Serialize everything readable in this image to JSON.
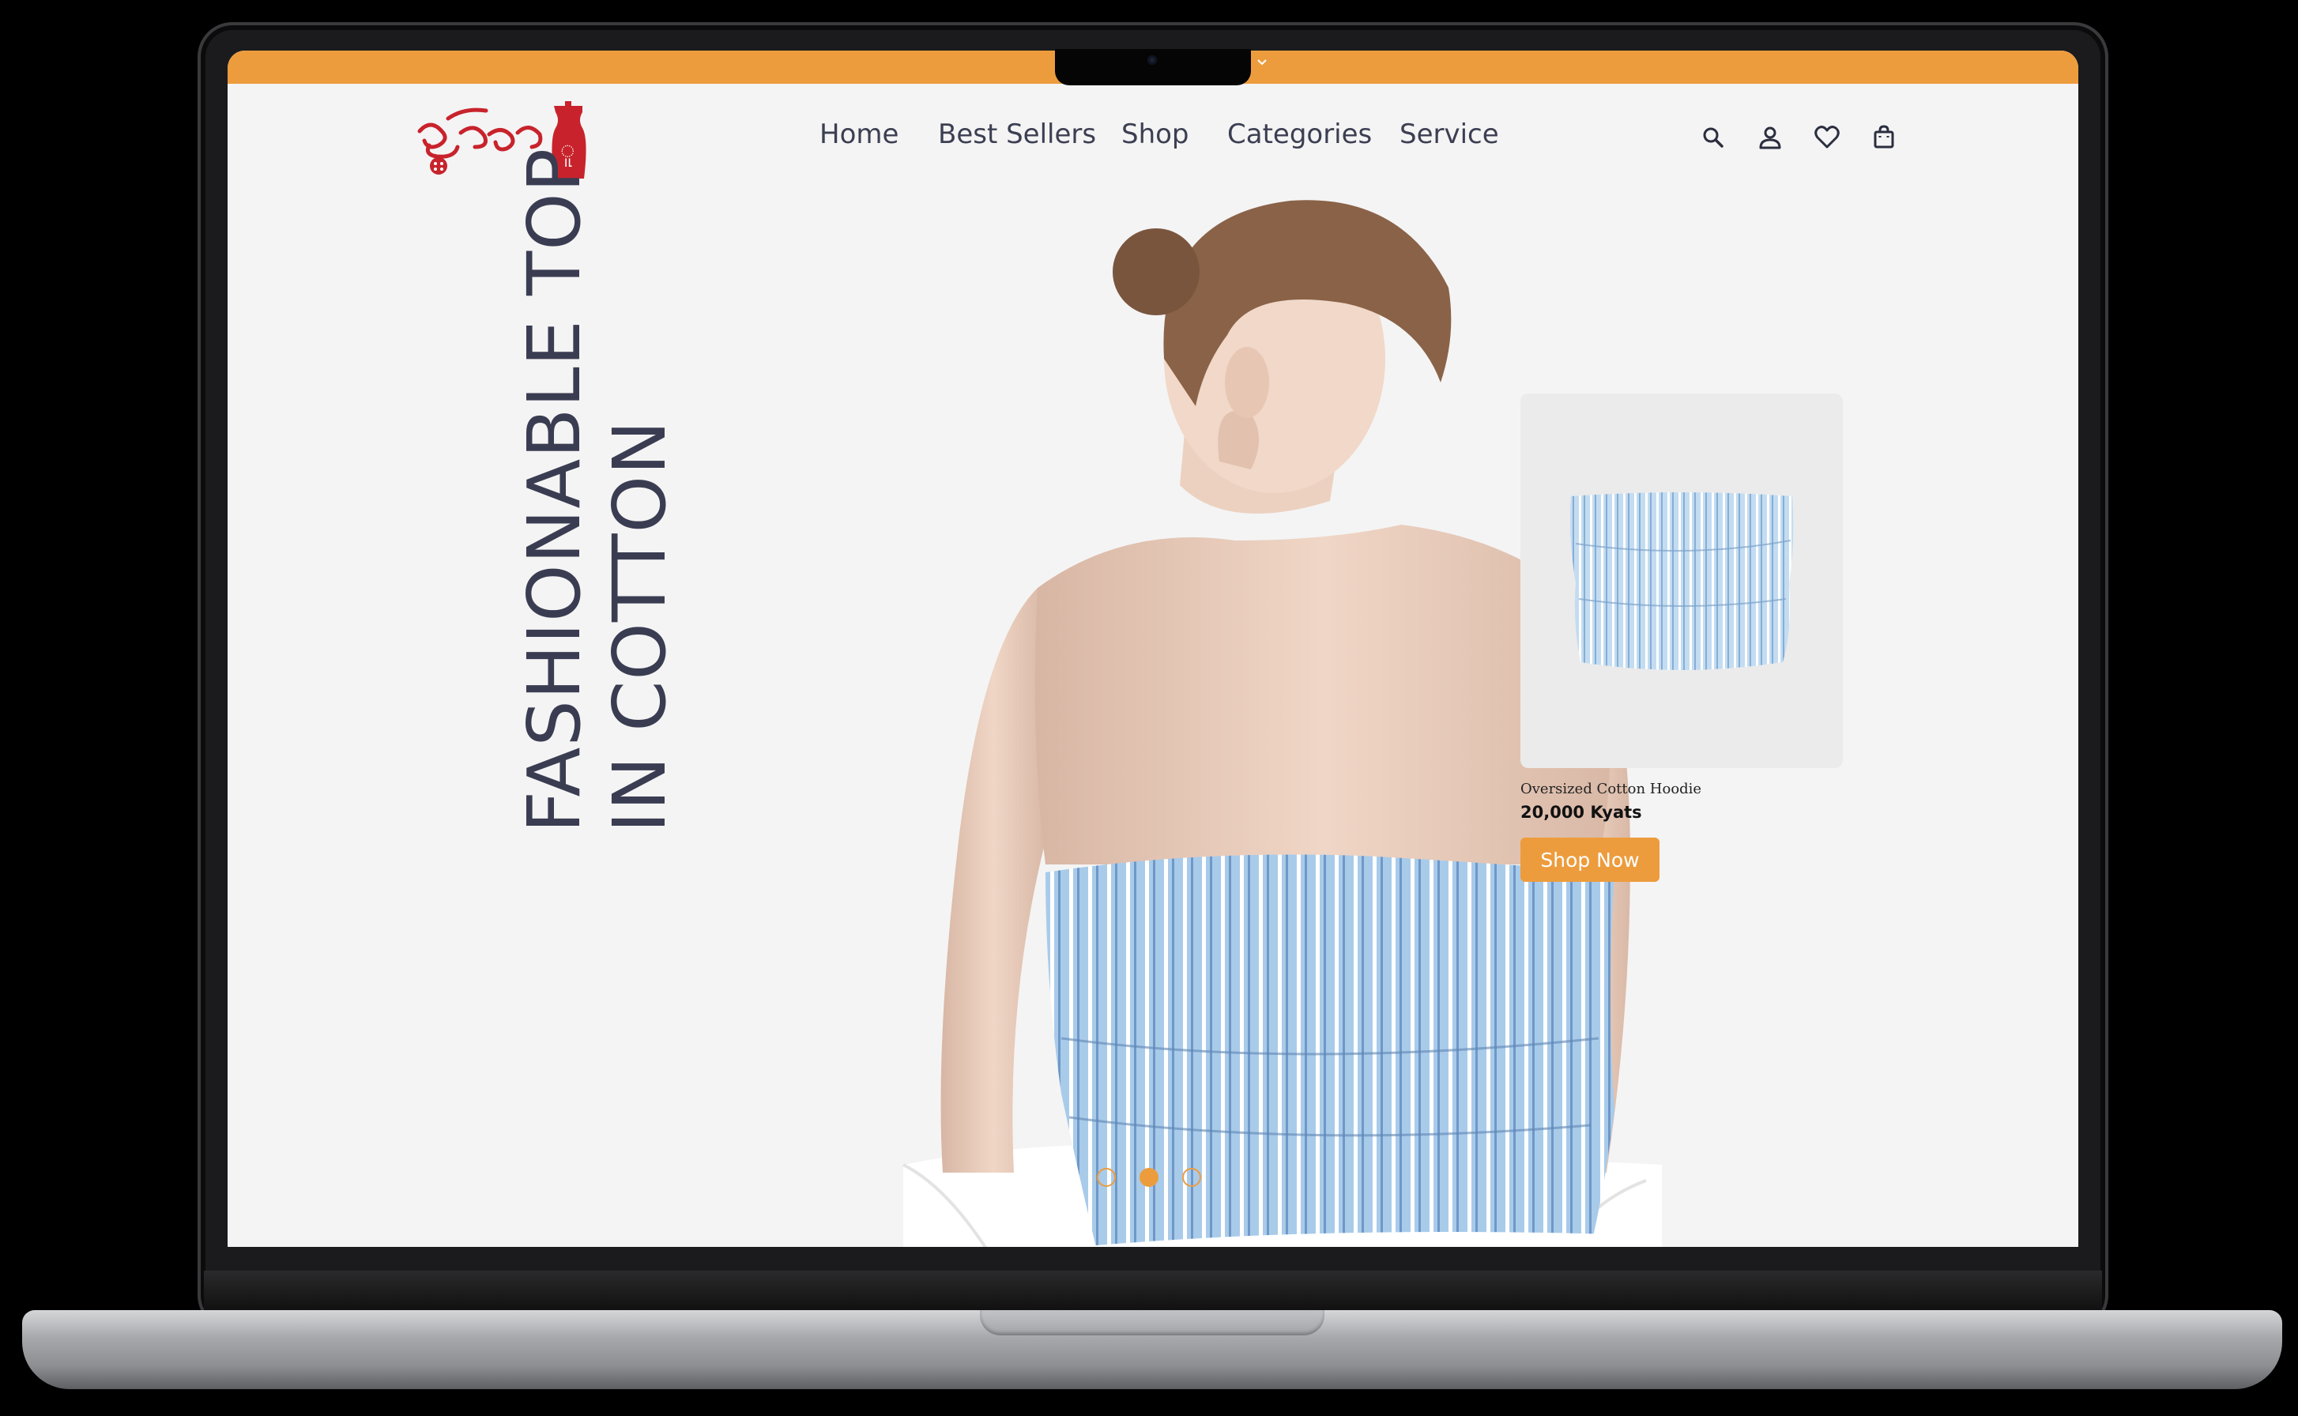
{
  "brand": {
    "logo_alt": "ရွှေသစ်ဆန်း",
    "logo_color": "#c8232c"
  },
  "topbar": {
    "color": "#ed9c3d"
  },
  "nav": {
    "items": [
      {
        "label": "Home"
      },
      {
        "label": "Best Sellers"
      },
      {
        "label": "Shop"
      },
      {
        "label": "Categories"
      },
      {
        "label": "Service"
      }
    ]
  },
  "header_icons": [
    "search-icon",
    "user-icon",
    "heart-icon",
    "shopping-bag-icon"
  ],
  "hero": {
    "title_line1": "FASHIONABLE TOP",
    "title_line2": "IN COTTON",
    "title_color": "#3a3d52"
  },
  "product": {
    "name": "Oversized Cotton Hoodie",
    "price": "20,000 Kyats",
    "button_label": "Shop Now",
    "button_color": "#ed9c3d"
  },
  "carousel": {
    "slides": 3,
    "active_index": 1
  }
}
